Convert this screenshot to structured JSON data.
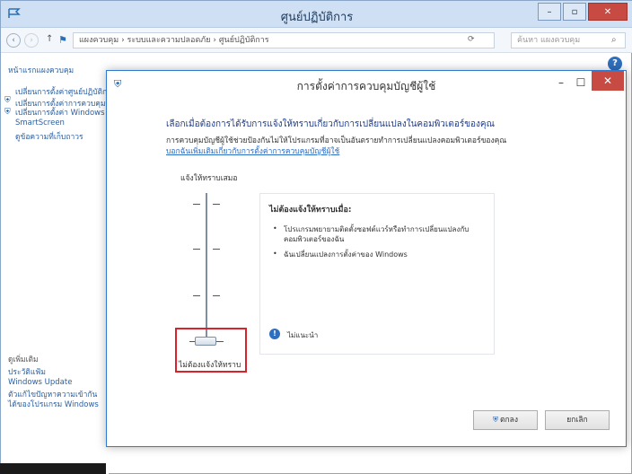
{
  "bg_window": {
    "title": "ศูนย์ปฏิบัติการ",
    "buttons": {
      "minimize": "–",
      "maximize": "▫",
      "close": "✕"
    },
    "breadcrumb": "แผงควบคุม › ระบบและความปลอดภัย › ศูนย์ปฏิบัติการ",
    "search_placeholder": "ค้นหา แผงควบคุม",
    "nav_back": "‹",
    "nav_forward": "›",
    "nav_up": "↑",
    "refresh": "⟳",
    "help": "?"
  },
  "sidebar": {
    "home_link": "หน้าแรกแผงควบคุม",
    "links": [
      "เปลี่ยนการตั้งค่าศูนย์ปฏิบัติการ",
      "เปลี่ยนการตั้งค่าการควบคุมบัญชีผู้ใช้",
      "เปลี่ยนการตั้งค่า Windows SmartScreen",
      "ดูข้อความที่เก็บถาวร"
    ],
    "see_also_heading": "ดูเพิ่มเติม",
    "see_also": [
      "ประวัติแฟ้ม",
      "Windows Update",
      "ตัวแก้ไขปัญหาความเข้ากันได้ของโปรแกรม Windows"
    ]
  },
  "dialog": {
    "title": "การตั้งค่าการควบคุมบัญชีผู้ใช้",
    "controls": {
      "minimize": "–",
      "maximize": "☐",
      "close": "✕"
    },
    "heading": "เลือกเมื่อต้องการได้รับการแจ้งให้ทราบเกี่ยวกับการเปลี่ยนแปลงในคอมพิวเตอร์ของคุณ",
    "description": "การควบคุมบัญชีผู้ใช้ช่วยป้องกันไม่ให้โปรแกรมที่อาจเป็นอันตรายทำการเปลี่ยนแปลงคอมพิวเตอร์ของคุณ",
    "link": "บอกฉันเพิ่มเติมเกี่ยวกับการตั้งค่าการควบคุมบัญชีผู้ใช้",
    "slider_top_label": "แจ้งให้ทราบเสมอ",
    "slider_bottom_label": "ไม่ต้องแจ้งให้ทราบ",
    "slider_level": 0,
    "info": {
      "title": "ไม่ต้องแจ้งให้ทราบเมื่อ:",
      "bullets": [
        "โปรแกรมพยายามติดตั้งซอฟต์แวร์หรือทำการเปลี่ยนแปลงกับคอมพิวเตอร์ของฉัน",
        "ฉันเปลี่ยนแปลงการตั้งค่าของ Windows"
      ],
      "note": "ไม่แนะนำ"
    },
    "ok_label": "ตกลง",
    "cancel_label": "ยกเลิก"
  },
  "colors": {
    "accent": "#2c7bd0",
    "close_red": "#c74a43",
    "highlight_red": "#d8232a",
    "heading_blue": "#1e3c8c"
  }
}
